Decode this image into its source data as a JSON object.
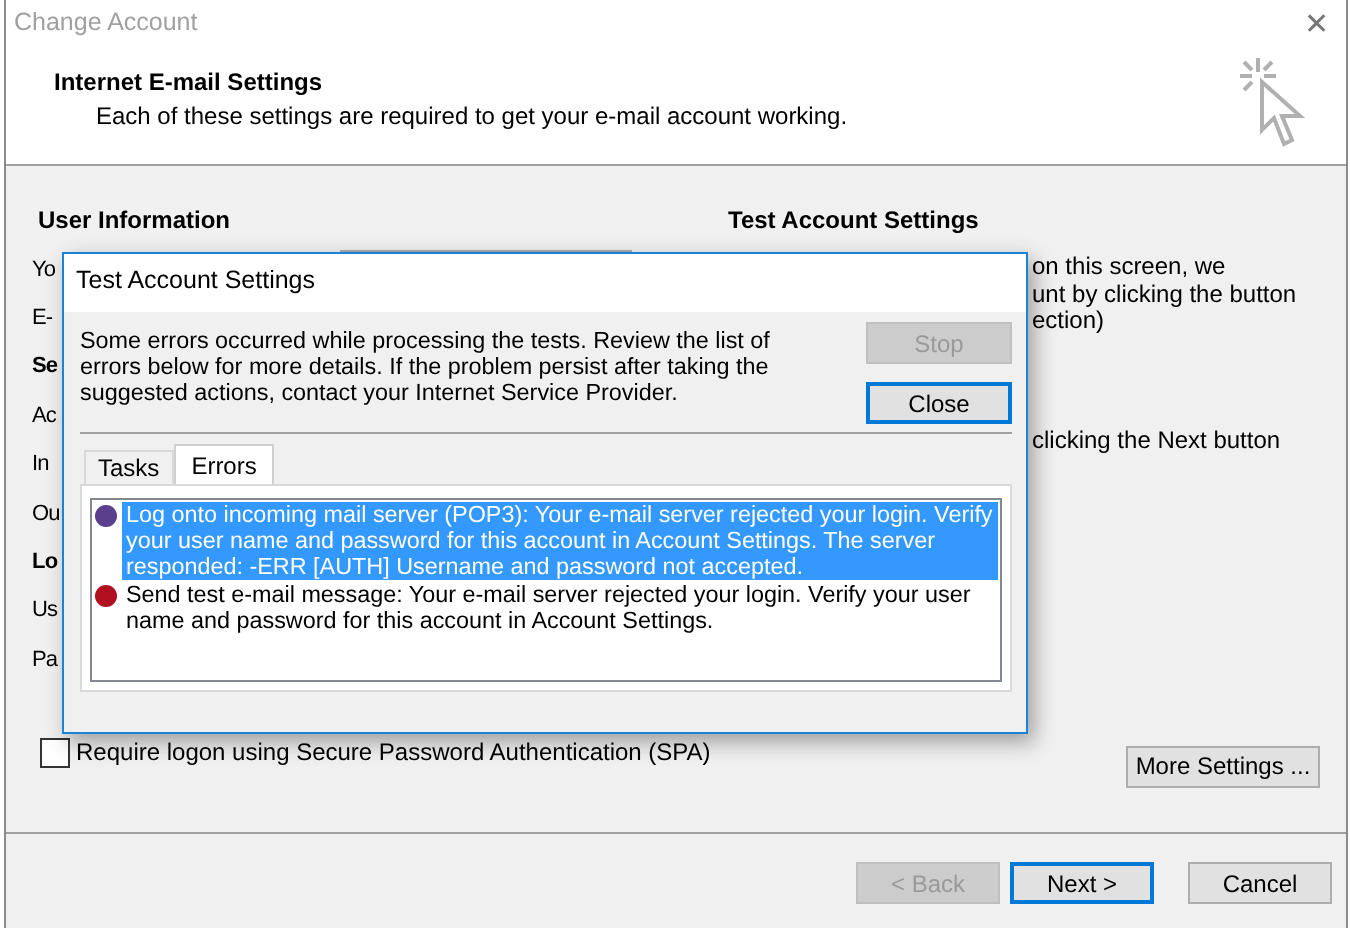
{
  "window": {
    "title": "Change Account",
    "close": "✕"
  },
  "header": {
    "title": "Internet E-mail Settings",
    "subtitle": "Each of these settings are required to get your e-mail account working."
  },
  "left_column": [
    {
      "kind": "heading",
      "text": "User Information"
    },
    {
      "kind": "label",
      "text": "Yo",
      "field": true
    },
    {
      "kind": "label",
      "text": "E-"
    },
    {
      "kind": "heading",
      "text": "Se"
    },
    {
      "kind": "label",
      "text": "Ac"
    },
    {
      "kind": "label",
      "text": "In"
    },
    {
      "kind": "label",
      "text": "Ou"
    },
    {
      "kind": "heading",
      "text": "Lo"
    },
    {
      "kind": "label",
      "text": "Us"
    },
    {
      "kind": "label",
      "text": "Pa"
    }
  ],
  "right_column": {
    "title": "Test Account Settings",
    "lines": [
      "on this screen, we",
      "unt by clicking the button",
      "ection)"
    ],
    "line_2": "clicking the Next button"
  },
  "spa_checkbox": {
    "label": "Require logon using Secure Password Authentication (SPA)",
    "checked": false
  },
  "more_settings_button": {
    "label": "More Settings ...",
    "disabled": false
  },
  "footer_buttons": [
    {
      "label": "< Back",
      "disabled": true,
      "default": false
    },
    {
      "label": "Next >",
      "disabled": false,
      "default": true
    },
    {
      "label": "Cancel",
      "disabled": false,
      "default": false
    }
  ],
  "dialog": {
    "title": "Test Account Settings",
    "message": "Some errors occurred while processing the tests. Review the list of errors below for more details. If the problem persist after taking the suggested actions, contact your Internet Service Provider.",
    "buttons": [
      {
        "label": "Stop",
        "disabled": true,
        "default": false
      },
      {
        "label": "Close",
        "disabled": false,
        "default": true
      }
    ],
    "tabs": [
      {
        "label": "Tasks",
        "selected": false
      },
      {
        "label": "Errors",
        "selected": true
      }
    ],
    "errors": [
      {
        "text": "Log onto incoming mail server (POP3): Your e-mail server rejected your login. Verify your user name and password for this account in Account Settings.  The server responded: -ERR [AUTH] Username and password not accepted.",
        "color": "#5a3f8c",
        "selected": true
      },
      {
        "text": "Send test e-mail message: Your e-mail server rejected your login. Verify your user name and password for this account in Account Settings.",
        "color": "#b01020",
        "selected": false
      }
    ]
  }
}
